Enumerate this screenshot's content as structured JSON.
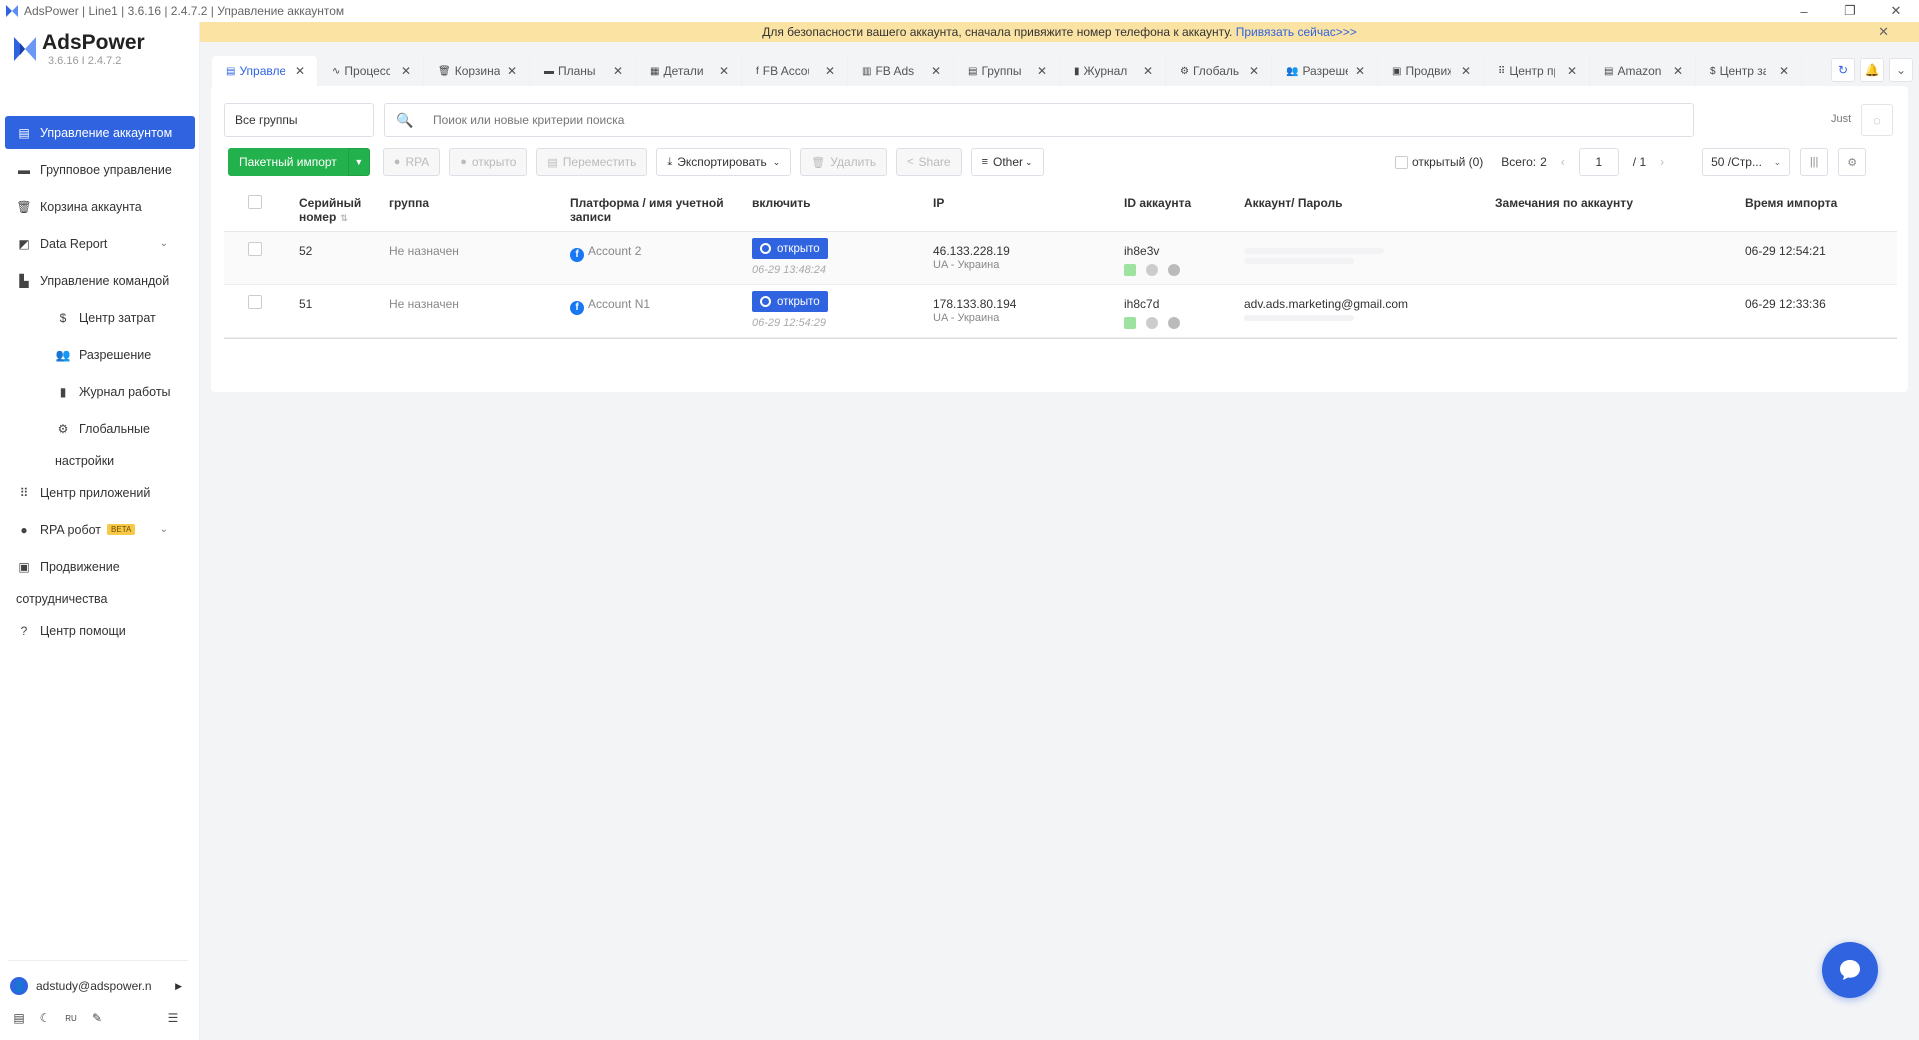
{
  "titlebar": {
    "title": "AdsPower | Line1 | 3.6.16 | 2.4.7.2 | Управление аккаунтом",
    "minimize": "–",
    "restore": "❐",
    "close": "✕"
  },
  "brand": {
    "name": "AdsPower",
    "version": "3.6.16  I  2.4.7.2",
    "accent_color": "#2f63e0"
  },
  "sidebar": {
    "items": [
      {
        "label": "Управление аккаунтом",
        "icon": "account-list-icon",
        "active": true
      },
      {
        "label": "Групповое управление",
        "icon": "group-icon"
      },
      {
        "label": "Корзина аккаунта",
        "icon": "trash-icon"
      },
      {
        "label": "Data Report",
        "icon": "report-icon",
        "expandable": true
      },
      {
        "label": "Управление командой",
        "icon": "team-icon"
      },
      {
        "label": "Центр затрат",
        "icon": "dollar-icon",
        "sub": true
      },
      {
        "label": "Разрешение",
        "icon": "users-icon",
        "sub": true
      },
      {
        "label": "Журнал работы",
        "icon": "log-icon",
        "sub": true
      },
      {
        "label": "Глобальные настройки",
        "icon": "gear-icon",
        "sub": true
      },
      {
        "label": "Центр приложений",
        "icon": "apps-icon"
      },
      {
        "label": "RPA робот",
        "icon": "robot-icon",
        "badge": "BETA",
        "expandable": true
      },
      {
        "label": "Продвижение сотрудничества",
        "icon": "promotion-icon"
      },
      {
        "label": "Центр помощи",
        "icon": "help-icon"
      }
    ],
    "user": "adstudy@adspower.n"
  },
  "notice": {
    "text": "Для безопасности вашего аккаунта, сначала привяжите номер телефона к аккаунту.",
    "link": "Привязать сейчас>>>",
    "close": "✕"
  },
  "tabs": [
    {
      "label": "Управление аккаунтом",
      "icon": "▤",
      "active": true
    },
    {
      "label": "Процесс",
      "icon": "∿"
    },
    {
      "label": "Корзина",
      "icon": "🗑"
    },
    {
      "label": "Планы",
      "icon": "▬"
    },
    {
      "label": "Детали",
      "icon": "▦"
    },
    {
      "label": "FB Accounts",
      "icon": "f"
    },
    {
      "label": "FB Ads",
      "icon": "▥"
    },
    {
      "label": "Группы",
      "icon": "▤"
    },
    {
      "label": "Журнал",
      "icon": "▮"
    },
    {
      "label": "Глобальные",
      "icon": "⚙"
    },
    {
      "label": "Разрешение",
      "icon": "👥"
    },
    {
      "label": "Продвижение",
      "icon": "▣"
    },
    {
      "label": "Центр приложений",
      "icon": "⠿"
    },
    {
      "label": "Amazon",
      "icon": "▤"
    },
    {
      "label": "Центр затрат",
      "icon": "$"
    }
  ],
  "filters": {
    "group_select": "Все группы",
    "search_placeholder": "Поиок или новые критерии поиска",
    "just_label": "Just"
  },
  "toolbar": {
    "batch_import": "Пакетный импорт",
    "rpa": "RPA",
    "open": "открыто",
    "move": "Переместить",
    "export": "Экспортировать",
    "delete": "Удалить",
    "share": "Share",
    "other": "Other"
  },
  "pager": {
    "opened_label": "открытый (0)",
    "total_label": "Всего:",
    "total_value": "2",
    "page": "1",
    "page_of": "/ 1",
    "per_page": "50 /Стр..."
  },
  "table": {
    "headers": {
      "serial": "Серийный номер",
      "group": "группа",
      "platform": "Платформа / имя учетной записи",
      "enable": "включить",
      "ip": "IP",
      "account_id": "ID аккаунта",
      "account_pass": "Аккаунт/ Пароль",
      "notes": "Замечания по аккаунту",
      "import_time": "Время импорта"
    },
    "rows": [
      {
        "serial": "52",
        "group": "Не назначен",
        "platform": "Account 2",
        "enable": "открыто",
        "enable_time": "06-29 13:48:24",
        "ip": "46.133.228.19",
        "ip_loc": "UA - Украина",
        "account_id": "ih8e3v",
        "account": "",
        "notes": "",
        "import_time": "06-29 12:54:21"
      },
      {
        "serial": "51",
        "group": "Не назначен",
        "platform": "Account N1",
        "enable": "открыто",
        "enable_time": "06-29 12:54:29",
        "ip": "178.133.80.194",
        "ip_loc": "UA - Украина",
        "account_id": "ih8c7d",
        "account": "adv.ads.marketing@gmail.com",
        "notes": "",
        "import_time": "06-29 12:33:36"
      }
    ]
  },
  "colors": {
    "primary": "#2f63e0",
    "success": "#22b14c",
    "notice_bg": "#fbe3a4"
  }
}
